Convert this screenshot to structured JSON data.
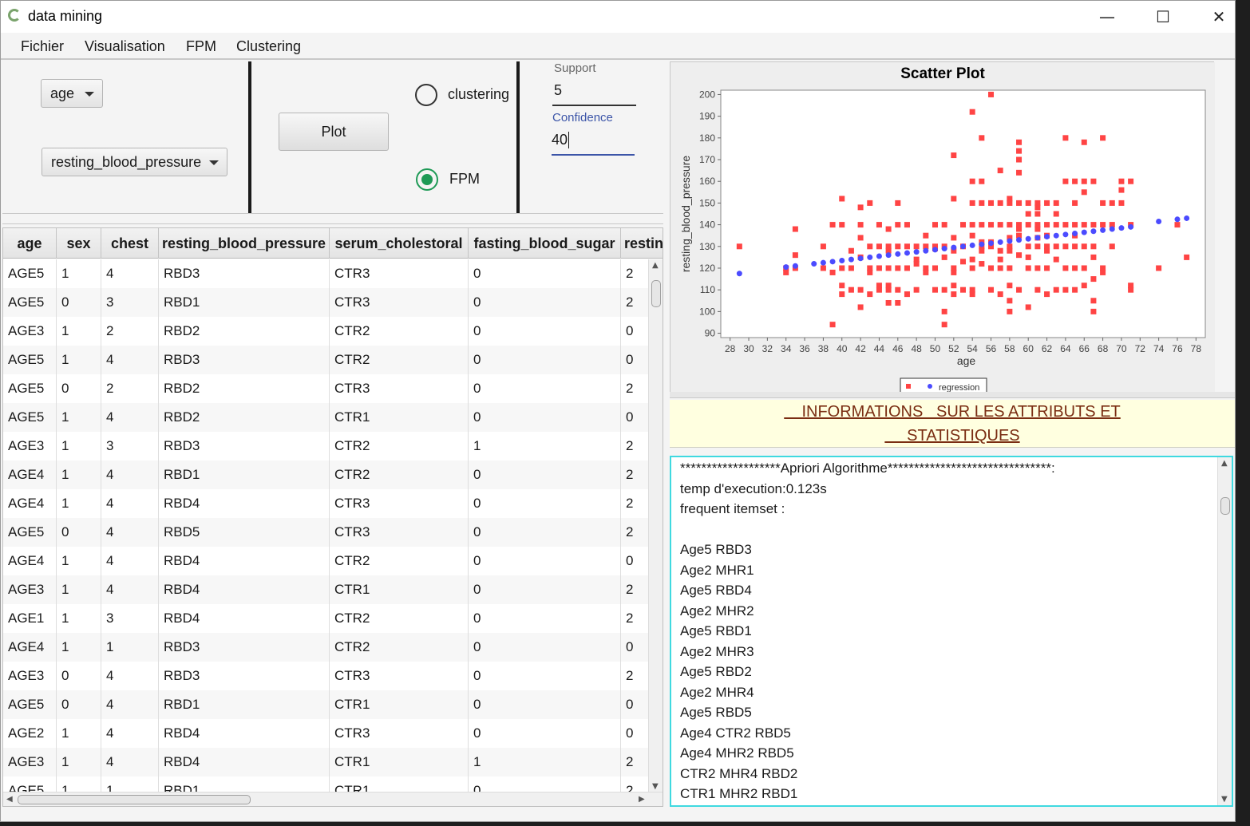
{
  "window": {
    "title": "data mining",
    "minimize": "—",
    "maximize": "☐",
    "close": "✕"
  },
  "menu": [
    "Fichier",
    "Visualisation",
    "FPM",
    "Clustering"
  ],
  "controls": {
    "x_select": "age",
    "y_select": "resting_blood_pressure",
    "plot_label": "Plot",
    "radio_clustering": "clustering",
    "radio_fpm": "FPM",
    "selected_mode": "FPM",
    "support_label": "Support",
    "support_value": "5",
    "confidence_label": "Confidence",
    "confidence_value": "40"
  },
  "table": {
    "columns": [
      "age",
      "sex",
      "chest",
      "resting_blood_pressure",
      "serum_cholestoral",
      "fasting_blood_sugar",
      "restin"
    ],
    "rows": [
      [
        "AGE5",
        "1",
        "4",
        "RBD3",
        "CTR3",
        "0",
        "2"
      ],
      [
        "AGE5",
        "0",
        "3",
        "RBD1",
        "CTR3",
        "0",
        "2"
      ],
      [
        "AGE3",
        "1",
        "2",
        "RBD2",
        "CTR2",
        "0",
        "0"
      ],
      [
        "AGE5",
        "1",
        "4",
        "RBD3",
        "CTR2",
        "0",
        "0"
      ],
      [
        "AGE5",
        "0",
        "2",
        "RBD2",
        "CTR3",
        "0",
        "2"
      ],
      [
        "AGE5",
        "1",
        "4",
        "RBD2",
        "CTR1",
        "0",
        "0"
      ],
      [
        "AGE3",
        "1",
        "3",
        "RBD3",
        "CTR2",
        "1",
        "2"
      ],
      [
        "AGE4",
        "1",
        "4",
        "RBD1",
        "CTR2",
        "0",
        "2"
      ],
      [
        "AGE4",
        "1",
        "4",
        "RBD4",
        "CTR3",
        "0",
        "2"
      ],
      [
        "AGE5",
        "0",
        "4",
        "RBD5",
        "CTR3",
        "0",
        "2"
      ],
      [
        "AGE4",
        "1",
        "4",
        "RBD4",
        "CTR2",
        "0",
        "0"
      ],
      [
        "AGE3",
        "1",
        "4",
        "RBD4",
        "CTR1",
        "0",
        "2"
      ],
      [
        "AGE1",
        "1",
        "3",
        "RBD4",
        "CTR2",
        "0",
        "2"
      ],
      [
        "AGE4",
        "1",
        "1",
        "RBD3",
        "CTR2",
        "0",
        "0"
      ],
      [
        "AGE3",
        "0",
        "4",
        "RBD3",
        "CTR3",
        "0",
        "2"
      ],
      [
        "AGE5",
        "0",
        "4",
        "RBD1",
        "CTR1",
        "0",
        "0"
      ],
      [
        "AGE2",
        "1",
        "4",
        "RBD4",
        "CTR3",
        "0",
        "0"
      ],
      [
        "AGE3",
        "1",
        "4",
        "RBD4",
        "CTR1",
        "1",
        "2"
      ],
      [
        "AGE5",
        "1",
        "1",
        "RBD1",
        "CTR1",
        "0",
        "2"
      ]
    ]
  },
  "chart_data": {
    "type": "scatter",
    "title": "Scatter Plot",
    "xlabel": "age",
    "ylabel": "resting_blood_pressure",
    "xlim": [
      27,
      79
    ],
    "ylim": [
      88,
      202
    ],
    "x_ticks": [
      28,
      30,
      32,
      34,
      36,
      38,
      40,
      42,
      44,
      46,
      48,
      50,
      52,
      54,
      56,
      58,
      60,
      62,
      64,
      66,
      68,
      70,
      72,
      74,
      76,
      78
    ],
    "y_ticks": [
      90,
      100,
      110,
      120,
      130,
      140,
      150,
      160,
      170,
      180,
      190,
      200
    ],
    "grid": false,
    "legend": "bottom-center",
    "series": [
      {
        "name": "",
        "color": "#ff4444",
        "marker": "square",
        "points": [
          [
            29,
            130
          ],
          [
            34,
            118
          ],
          [
            34,
            120
          ],
          [
            35,
            138
          ],
          [
            35,
            126
          ],
          [
            35,
            120
          ],
          [
            38,
            120
          ],
          [
            38,
            130
          ],
          [
            39,
            94
          ],
          [
            39,
            140
          ],
          [
            39,
            118
          ],
          [
            40,
            152
          ],
          [
            40,
            140
          ],
          [
            40,
            120
          ],
          [
            40,
            108
          ],
          [
            40,
            112
          ],
          [
            41,
            128
          ],
          [
            41,
            110
          ],
          [
            41,
            120
          ],
          [
            42,
            148
          ],
          [
            42,
            140
          ],
          [
            42,
            134
          ],
          [
            42,
            125
          ],
          [
            42,
            110
          ],
          [
            42,
            102
          ],
          [
            43,
            150
          ],
          [
            43,
            130
          ],
          [
            43,
            120
          ],
          [
            43,
            118
          ],
          [
            43,
            108
          ],
          [
            44,
            140
          ],
          [
            44,
            130
          ],
          [
            44,
            120
          ],
          [
            44,
            112
          ],
          [
            44,
            110
          ],
          [
            45,
            138
          ],
          [
            45,
            130
          ],
          [
            45,
            128
          ],
          [
            45,
            120
          ],
          [
            45,
            112
          ],
          [
            45,
            110
          ],
          [
            45,
            104
          ],
          [
            46,
            150
          ],
          [
            46,
            140
          ],
          [
            46,
            130
          ],
          [
            46,
            120
          ],
          [
            46,
            110
          ],
          [
            46,
            104
          ],
          [
            47,
            140
          ],
          [
            47,
            130
          ],
          [
            47,
            120
          ],
          [
            47,
            108
          ],
          [
            48,
            130
          ],
          [
            48,
            124
          ],
          [
            48,
            122
          ],
          [
            48,
            110
          ],
          [
            49,
            135
          ],
          [
            49,
            130
          ],
          [
            49,
            120
          ],
          [
            49,
            118
          ],
          [
            50,
            140
          ],
          [
            50,
            130
          ],
          [
            50,
            129
          ],
          [
            50,
            120
          ],
          [
            50,
            110
          ],
          [
            51,
            140
          ],
          [
            51,
            130
          ],
          [
            51,
            125
          ],
          [
            51,
            110
          ],
          [
            51,
            100
          ],
          [
            51,
            94
          ],
          [
            52,
            172
          ],
          [
            52,
            152
          ],
          [
            52,
            134
          ],
          [
            52,
            128
          ],
          [
            52,
            120
          ],
          [
            52,
            118
          ],
          [
            52,
            112
          ],
          [
            52,
            108
          ],
          [
            53,
            140
          ],
          [
            53,
            130
          ],
          [
            53,
            123
          ],
          [
            53,
            110
          ],
          [
            54,
            192
          ],
          [
            54,
            160
          ],
          [
            54,
            150
          ],
          [
            54,
            140
          ],
          [
            54,
            135
          ],
          [
            54,
            124
          ],
          [
            54,
            120
          ],
          [
            54,
            110
          ],
          [
            54,
            108
          ],
          [
            55,
            180
          ],
          [
            55,
            160
          ],
          [
            55,
            150
          ],
          [
            55,
            140
          ],
          [
            55,
            132
          ],
          [
            55,
            130
          ],
          [
            55,
            128
          ],
          [
            55,
            122
          ],
          [
            56,
            200
          ],
          [
            56,
            150
          ],
          [
            56,
            140
          ],
          [
            56,
            132
          ],
          [
            56,
            130
          ],
          [
            56,
            120
          ],
          [
            56,
            110
          ],
          [
            57,
            165
          ],
          [
            57,
            150
          ],
          [
            57,
            140
          ],
          [
            57,
            128
          ],
          [
            57,
            124
          ],
          [
            57,
            120
          ],
          [
            57,
            108
          ],
          [
            58,
            152
          ],
          [
            58,
            150
          ],
          [
            58,
            140
          ],
          [
            58,
            134
          ],
          [
            58,
            130
          ],
          [
            58,
            128
          ],
          [
            58,
            120
          ],
          [
            58,
            112
          ],
          [
            58,
            105
          ],
          [
            58,
            100
          ],
          [
            59,
            178
          ],
          [
            59,
            174
          ],
          [
            59,
            170
          ],
          [
            59,
            164
          ],
          [
            59,
            150
          ],
          [
            59,
            140
          ],
          [
            59,
            138
          ],
          [
            59,
            135
          ],
          [
            59,
            126
          ],
          [
            59,
            110
          ],
          [
            60,
            150
          ],
          [
            60,
            145
          ],
          [
            60,
            140
          ],
          [
            60,
            130
          ],
          [
            60,
            125
          ],
          [
            60,
            120
          ],
          [
            60,
            102
          ],
          [
            61,
            150
          ],
          [
            61,
            148
          ],
          [
            61,
            145
          ],
          [
            61,
            140
          ],
          [
            61,
            138
          ],
          [
            61,
            134
          ],
          [
            61,
            130
          ],
          [
            61,
            120
          ],
          [
            61,
            110
          ],
          [
            62,
            150
          ],
          [
            62,
            140
          ],
          [
            62,
            135
          ],
          [
            62,
            130
          ],
          [
            62,
            128
          ],
          [
            62,
            120
          ],
          [
            62,
            108
          ],
          [
            63,
            150
          ],
          [
            63,
            145
          ],
          [
            63,
            140
          ],
          [
            63,
            130
          ],
          [
            63,
            124
          ],
          [
            63,
            110
          ],
          [
            64,
            180
          ],
          [
            64,
            160
          ],
          [
            64,
            140
          ],
          [
            64,
            130
          ],
          [
            64,
            120
          ],
          [
            64,
            110
          ],
          [
            65,
            160
          ],
          [
            65,
            150
          ],
          [
            65,
            140
          ],
          [
            65,
            135
          ],
          [
            65,
            130
          ],
          [
            65,
            120
          ],
          [
            65,
            110
          ],
          [
            66,
            178
          ],
          [
            66,
            160
          ],
          [
            66,
            155
          ],
          [
            66,
            140
          ],
          [
            66,
            130
          ],
          [
            66,
            120
          ],
          [
            66,
            112
          ],
          [
            67,
            160
          ],
          [
            67,
            140
          ],
          [
            67,
            130
          ],
          [
            67,
            125
          ],
          [
            67,
            115
          ],
          [
            67,
            105
          ],
          [
            67,
            100
          ],
          [
            68,
            180
          ],
          [
            68,
            150
          ],
          [
            68,
            140
          ],
          [
            68,
            120
          ],
          [
            68,
            118
          ],
          [
            69,
            150
          ],
          [
            69,
            140
          ],
          [
            69,
            130
          ],
          [
            70,
            160
          ],
          [
            70,
            156
          ],
          [
            70,
            150
          ],
          [
            71,
            160
          ],
          [
            71,
            140
          ],
          [
            71,
            112
          ],
          [
            71,
            110
          ],
          [
            74,
            120
          ],
          [
            76,
            140
          ],
          [
            77,
            125
          ]
        ]
      },
      {
        "name": "regression",
        "color": "#4b4bff",
        "marker": "circle",
        "points": [
          [
            29,
            117.5
          ],
          [
            34,
            120.5
          ],
          [
            35,
            121
          ],
          [
            37,
            122
          ],
          [
            38,
            122.5
          ],
          [
            39,
            123
          ],
          [
            40,
            123.5
          ],
          [
            41,
            124
          ],
          [
            42,
            124.5
          ],
          [
            43,
            125
          ],
          [
            44,
            125.5
          ],
          [
            45,
            126
          ],
          [
            46,
            126.5
          ],
          [
            47,
            127
          ],
          [
            48,
            127.5
          ],
          [
            49,
            128
          ],
          [
            50,
            128.5
          ],
          [
            51,
            129
          ],
          [
            52,
            129.5
          ],
          [
            53,
            130
          ],
          [
            54,
            130.5
          ],
          [
            55,
            131
          ],
          [
            56,
            131.5
          ],
          [
            57,
            132
          ],
          [
            58,
            132.5
          ],
          [
            59,
            133
          ],
          [
            60,
            133.5
          ],
          [
            61,
            134
          ],
          [
            62,
            134.5
          ],
          [
            63,
            135
          ],
          [
            64,
            135.5
          ],
          [
            65,
            136
          ],
          [
            66,
            136.5
          ],
          [
            67,
            137
          ],
          [
            68,
            137.5
          ],
          [
            69,
            138
          ],
          [
            70,
            138.5
          ],
          [
            71,
            139
          ],
          [
            74,
            141.5
          ],
          [
            76,
            142.5
          ],
          [
            77,
            143
          ]
        ]
      }
    ]
  },
  "info": {
    "title_line1": "    INFORMATIONS   SUR LES ATTRIBUTS ET",
    "title_line2": "     STATISTIQUES",
    "lines": [
      "*******************Apriori Algorithme*******************************:",
      "temp d'execution:0.123s",
      "frequent itemset :",
      "",
      "Age5 RBD3",
      "Age2 MHR1",
      "Age5 RBD4",
      "Age2 MHR2",
      "Age5 RBD1",
      "Age2 MHR3",
      "Age5 RBD2",
      "Age2 MHR4",
      "Age5 RBD5",
      "Age4 CTR2 RBD5",
      "Age4 MHR2 RBD5",
      "CTR2 MHR4 RBD2",
      "CTR1 MHR2 RBD1"
    ]
  },
  "colors": {
    "accent_green": "#1e9a56",
    "confidence_blue": "#3c55a8",
    "text_area_border": "#3fd9e0",
    "info_bg": "#ffffe0",
    "info_text": "#7a2d12"
  },
  "icons": {
    "app": "app-icon",
    "dropdown": "chevron-down-icon"
  }
}
